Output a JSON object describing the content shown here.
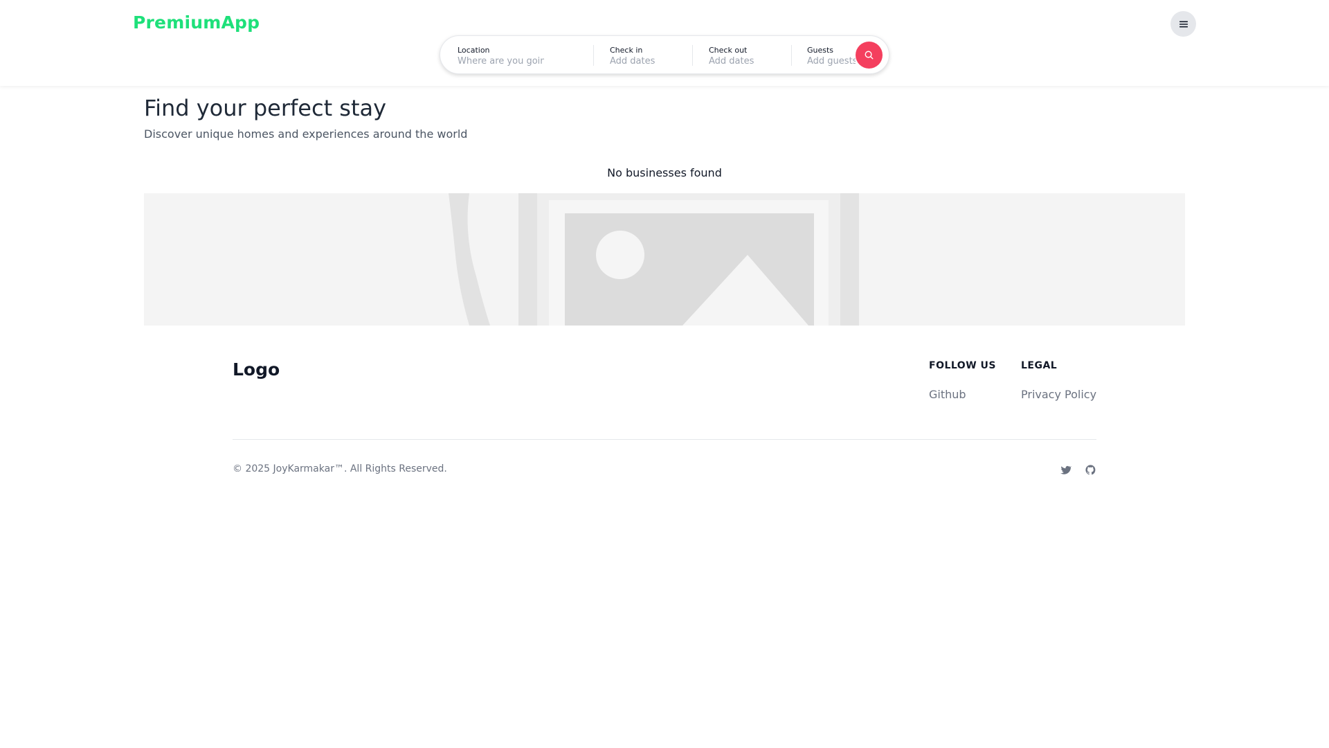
{
  "colors": {
    "brand": "#1ee07a",
    "search_button": "#f43f5e",
    "muted_text": "#6b7280"
  },
  "header": {
    "brand": "PremiumApp",
    "menu_icon": "hamburger-menu-icon",
    "search": {
      "location": {
        "label": "Location",
        "placeholder": "Where are you going"
      },
      "check_in": {
        "label": "Check in",
        "placeholder": "Add dates"
      },
      "check_out": {
        "label": "Check out",
        "placeholder": "Add dates"
      },
      "guests": {
        "label": "Guests",
        "placeholder": "Add guests"
      },
      "button_icon": "search-icon"
    }
  },
  "main": {
    "title": "Find your perfect stay",
    "subtitle": "Discover unique homes and experiences around the world",
    "empty_message": "No businesses found",
    "image_icon": "image-placeholder-icon"
  },
  "footer": {
    "logo": "Logo",
    "columns": [
      {
        "heading": "FOLLOW US",
        "links": [
          "Github"
        ]
      },
      {
        "heading": "LEGAL",
        "links": [
          "Privacy Policy"
        ]
      }
    ],
    "copyright": "© 2025 JoyKarmakar™. All Rights Reserved.",
    "social_icons": [
      "twitter-icon",
      "github-icon"
    ]
  }
}
